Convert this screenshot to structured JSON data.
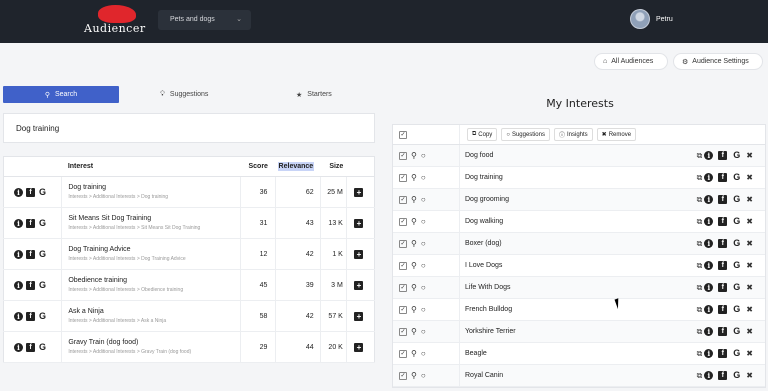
{
  "header": {
    "logo_text": "Audiencer",
    "audience_selector": "Pets and dogs",
    "user_name": "Petru"
  },
  "toolbar": {
    "all_audiences": "All Audiences",
    "audience_settings": "Audience Settings"
  },
  "tabs": {
    "search": "Search",
    "suggestions": "Suggestions",
    "starters": "Starters"
  },
  "search": {
    "query": "Dog training"
  },
  "results": {
    "headers": {
      "interest": "Interest",
      "score": "Score",
      "relevance": "Relevance",
      "size": "Size"
    },
    "rows": [
      {
        "name": "Dog training",
        "path": "Interests > Additional Interests > Dog training",
        "score": "36",
        "relevance": "62",
        "size": "25 M"
      },
      {
        "name": "Sit Means Sit Dog Training",
        "path": "Interests > Additional Interests > Sit Means Sit Dog Training",
        "score": "31",
        "relevance": "43",
        "size": "13 K"
      },
      {
        "name": "Dog Training Advice",
        "path": "Interests > Additional Interests > Dog Training Advice",
        "score": "12",
        "relevance": "42",
        "size": "1 K"
      },
      {
        "name": "Obedience training",
        "path": "Interests > Additional Interests > Obedience training",
        "score": "45",
        "relevance": "39",
        "size": "3 M"
      },
      {
        "name": "Ask a Ninja",
        "path": "Interests > Additional Interests > Ask a Ninja",
        "score": "58",
        "relevance": "42",
        "size": "57 K"
      },
      {
        "name": "Gravy Train (dog food)",
        "path": "Interests > Additional Interests > Gravy Train (dog food)",
        "score": "29",
        "relevance": "44",
        "size": "20 K"
      }
    ]
  },
  "my_interests": {
    "title": "My Interests",
    "actions": {
      "copy": "Copy",
      "suggestions": "Suggestions",
      "insights": "Insights",
      "remove": "Remove"
    },
    "items": [
      "Dog food",
      "Dog training",
      "Dog grooming",
      "Dog walking",
      "Boxer (dog)",
      "I Love Dogs",
      "Life With Dogs",
      "French Bulldog",
      "Yorkshire Terrier",
      "Beagle",
      "Royal Canin"
    ]
  }
}
